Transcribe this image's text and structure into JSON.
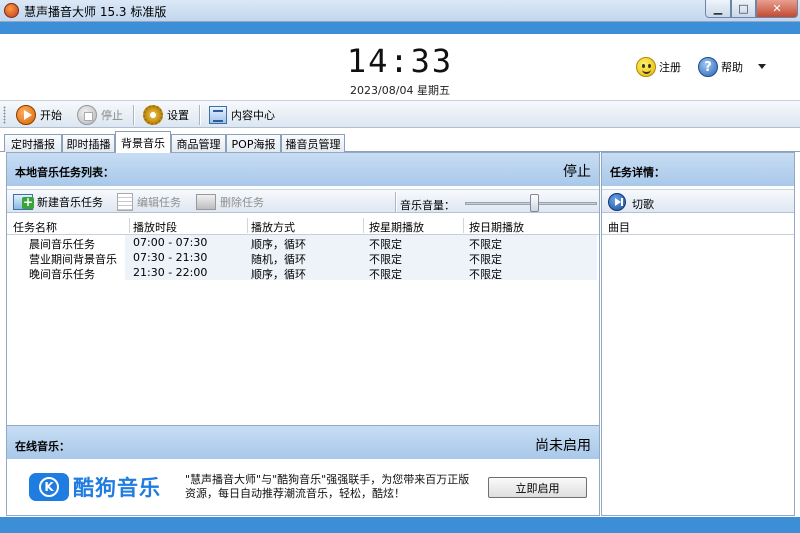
{
  "window": {
    "title": "慧声播音大师 15.3 标准版"
  },
  "header": {
    "time": "14:33",
    "date": "2023/08/04 星期五",
    "register_label": "注册",
    "help_label": "帮助"
  },
  "toolbar": {
    "start_label": "开始",
    "stop_label": "停止",
    "settings_label": "设置",
    "content_center_label": "内容中心"
  },
  "tabs": [
    {
      "label": "定时播报"
    },
    {
      "label": "即时插播"
    },
    {
      "label": "背景音乐"
    },
    {
      "label": "商品管理"
    },
    {
      "label": "POP海报"
    },
    {
      "label": "播音员管理"
    }
  ],
  "active_tab": "背景音乐",
  "left_panel": {
    "title": "本地音乐任务列表：",
    "status": "停止",
    "new_task_label": "新建音乐任务",
    "edit_task_label": "编辑任务",
    "delete_task_label": "删除任务",
    "volume_label": "音乐音量：",
    "volume_level": 0.52,
    "columns": [
      "任务名称",
      "播放时段",
      "播放方式",
      "按星期播放",
      "按日期播放"
    ],
    "rows": [
      {
        "name": "晨间音乐任务",
        "period": "07:00 - 07:30",
        "mode": "顺序，循环",
        "week": "不限定",
        "date": "不限定"
      },
      {
        "name": "营业期间背景音乐",
        "period": "07:30 - 21:30",
        "mode": "随机，循环",
        "week": "不限定",
        "date": "不限定"
      },
      {
        "name": "晚间音乐任务",
        "period": "21:30 - 22:00",
        "mode": "顺序，循环",
        "week": "不限定",
        "date": "不限定"
      }
    ]
  },
  "online": {
    "title": "在线音乐：",
    "status": "尚未启用",
    "brand": "酷狗音乐",
    "promo_line1": "\"慧声播音大师\"与\"酷狗音乐\"强强联手，为您带来百万正版",
    "promo_line2": "资源，每日自动推荐潮流音乐，轻松，酷炫！",
    "enable_label": "立即启用"
  },
  "right_panel": {
    "title": "任务详情：",
    "cut_label": "切歌",
    "track_column": "曲目"
  },
  "colors": {
    "accent_blue": "#3c8fd6",
    "panel_head": "#b8d2ee",
    "kugou_blue": "#1f7ce0"
  }
}
